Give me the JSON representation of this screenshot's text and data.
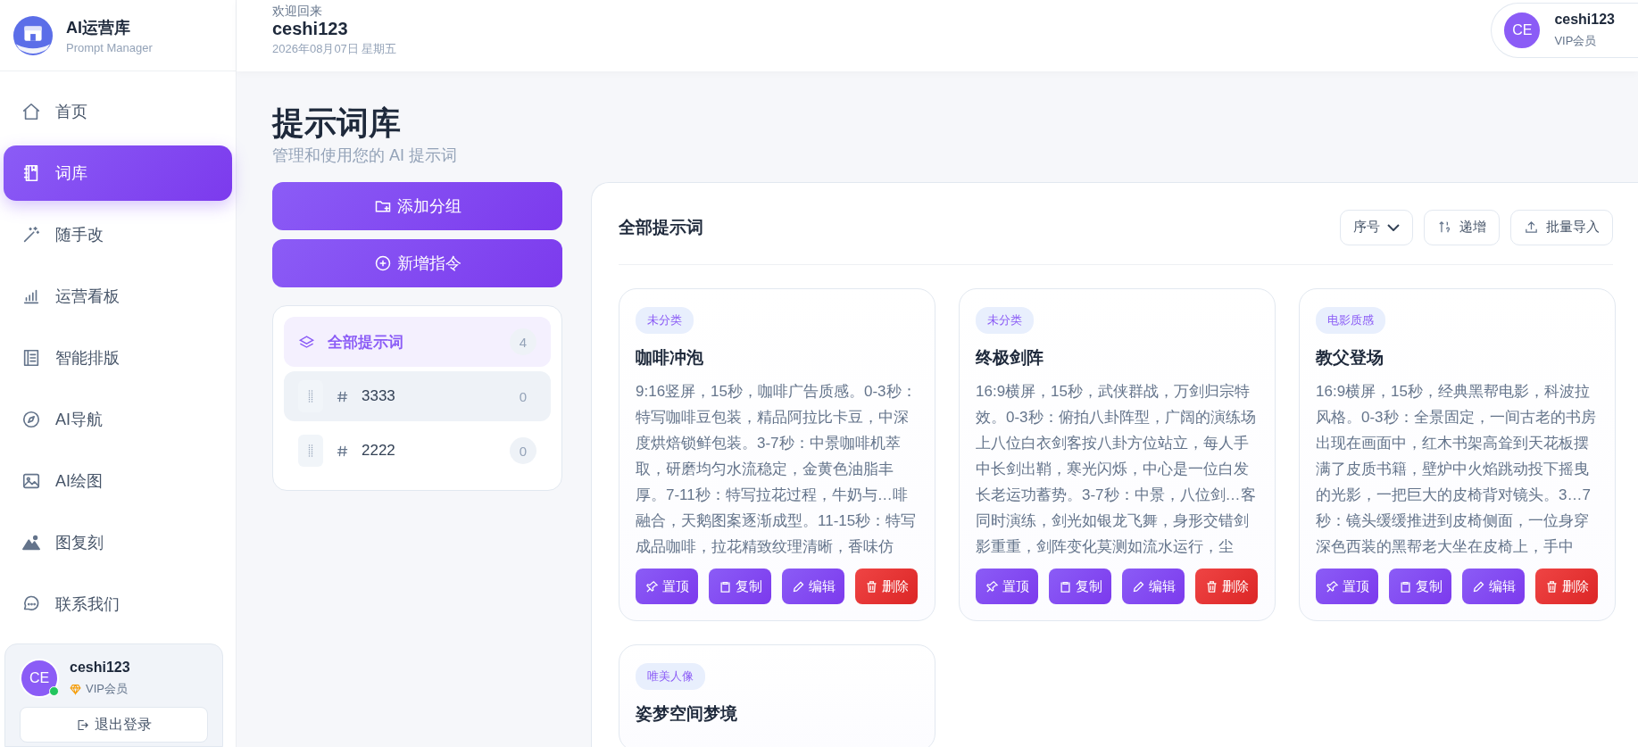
{
  "brand": {
    "name": "AI运营库",
    "subtitle": "Prompt Manager"
  },
  "nav": [
    {
      "label": "首页",
      "selected": false
    },
    {
      "label": "词库",
      "selected": true
    },
    {
      "label": "随手改",
      "selected": false
    },
    {
      "label": "运营看板",
      "selected": false
    },
    {
      "label": "智能排版",
      "selected": false
    },
    {
      "label": "AI导航",
      "selected": false
    },
    {
      "label": "AI绘图",
      "selected": false
    },
    {
      "label": "图复刻",
      "selected": false
    },
    {
      "label": "联系我们",
      "selected": false
    }
  ],
  "sidebar_user": {
    "avatar": "CE",
    "name": "ceshi123",
    "badge": "VIP会员",
    "online": true,
    "logout": "退出登录"
  },
  "header": {
    "greeting": "欢迎回来",
    "name": "ceshi123",
    "date": "2026年08月07日 星期五",
    "user": {
      "avatar": "CE",
      "name": "ceshi123",
      "badge": "VIP会员"
    }
  },
  "page": {
    "title": "提示词库",
    "subtitle": "管理和使用您的 AI 提示词"
  },
  "actions": [
    "添加分组",
    "新增指令"
  ],
  "groups": [
    {
      "kind": "all",
      "label": "全部提示词",
      "count": "4",
      "selected": true,
      "hovered": false
    },
    {
      "kind": "group",
      "label": "3333",
      "count": "0",
      "selected": false,
      "hovered": true
    },
    {
      "kind": "group",
      "label": "2222",
      "count": "0",
      "selected": false,
      "hovered": false
    }
  ],
  "panel": {
    "title": "全部提示词",
    "sort": "序号",
    "order": "递增",
    "import": "批量导入"
  },
  "cards": [
    {
      "tag": "未分类",
      "title": "咖啡冲泡",
      "text": "9:16竖屏，15秒，咖啡广告质感。0-3秒：特写咖啡豆包装，精品阿拉比卡豆，中深度烘焙锁鲜包装。3-7秒：中景咖啡机萃取，研磨均匀水流稳定，金黄色油脂丰厚。7-11秒：特写拉花过程，牛奶与…啡融合，天鹅图案逐渐成型。11-15秒：特写成品咖啡，拉花精致纹理清晰，香味仿",
      "buttons": [
        {
          "kind": "pin",
          "label": "置顶"
        },
        {
          "kind": "copy",
          "label": "复制"
        },
        {
          "kind": "edit",
          "label": "编辑"
        },
        {
          "kind": "delete",
          "label": "删除"
        }
      ]
    },
    {
      "tag": "未分类",
      "title": "终极剑阵",
      "text": "16:9横屏，15秒，武侠群战，万剑归宗特效。0-3秒：俯拍八卦阵型，广阔的演练场上八位白衣剑客按八卦方位站立，每人手中长剑出鞘，寒光闪烁，中心是一位白发长老运功蓄势。3-7秒：中景，八位剑…客同时演练，剑光如银龙飞舞，身形交错剑影重重，剑阵变化莫测如流水运行，尘",
      "buttons": [
        {
          "kind": "pin",
          "label": "置顶"
        },
        {
          "kind": "copy",
          "label": "复制"
        },
        {
          "kind": "edit",
          "label": "编辑"
        },
        {
          "kind": "delete",
          "label": "删除"
        }
      ]
    },
    {
      "tag": "电影质感",
      "title": "教父登场",
      "text": "16:9横屏，15秒，经典黑帮电影，科波拉风格。0-3秒：全景固定，一间古老的书房出现在画面中，红木书架高耸到天花板摆满了皮质书籍，壁炉中火焰跳动投下摇曳的光影，一把巨大的皮椅背对镜头。3…7秒：镜头缓缓推进到皮椅侧面，一位身穿深色西装的黑帮老大坐在皮椅上，手中",
      "buttons": [
        {
          "kind": "pin",
          "label": "置顶"
        },
        {
          "kind": "copy",
          "label": "复制"
        },
        {
          "kind": "edit",
          "label": "编辑"
        },
        {
          "kind": "delete",
          "label": "删除"
        }
      ]
    },
    {
      "tag": "唯美人像",
      "title": "姿梦空间梦境"
    }
  ]
}
